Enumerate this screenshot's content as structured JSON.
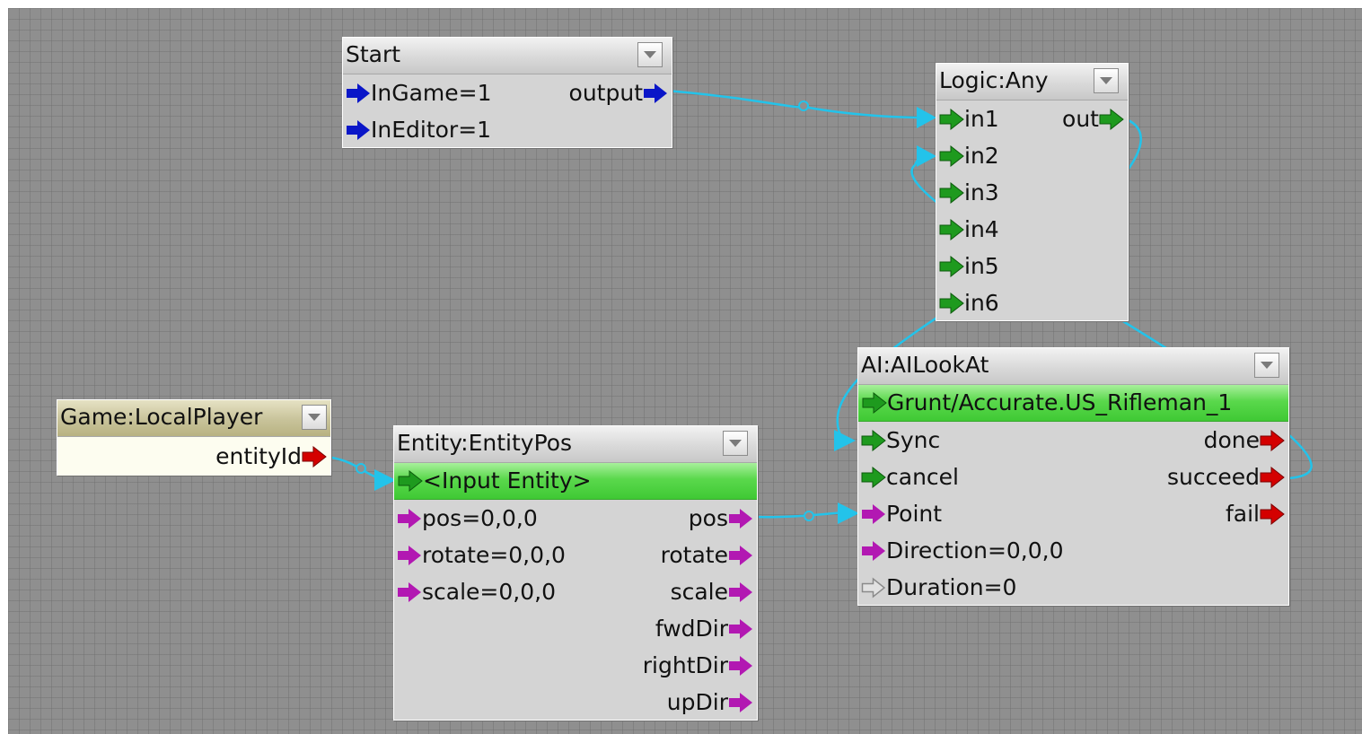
{
  "colors": {
    "canvas": "#8f8f8f",
    "node_body": "#d4d4d4",
    "wire": "#23c3ea",
    "port_blue": "#0a16c8",
    "port_green": "#1e9a1e",
    "port_magenta": "#b218b2",
    "port_red": "#d40000",
    "port_gray": "#9a9a9a",
    "entity_row": "#4fd443"
  },
  "nodes": {
    "start": {
      "title": "Start",
      "inputs": [
        {
          "label": "InGame=1",
          "port_icon": "blue-arrow-icon"
        },
        {
          "label": "InEditor=1",
          "port_icon": "blue-arrow-icon"
        }
      ],
      "outputs": [
        {
          "label": "output",
          "port_icon": "blue-arrow-icon"
        }
      ]
    },
    "logic_any": {
      "title": "Logic:Any",
      "inputs": [
        {
          "label": "in1",
          "port_icon": "green-arrow-icon"
        },
        {
          "label": "in2",
          "port_icon": "green-arrow-icon"
        },
        {
          "label": "in3",
          "port_icon": "green-arrow-icon"
        },
        {
          "label": "in4",
          "port_icon": "green-arrow-icon"
        },
        {
          "label": "in5",
          "port_icon": "green-arrow-icon"
        },
        {
          "label": "in6",
          "port_icon": "green-arrow-icon"
        }
      ],
      "outputs": [
        {
          "label": "out",
          "port_icon": "green-arrow-icon"
        }
      ]
    },
    "local_player": {
      "title": "Game:LocalPlayer",
      "outputs": [
        {
          "label": "entityId",
          "port_icon": "red-arrow-icon"
        }
      ]
    },
    "entity_pos": {
      "title": "Entity:EntityPos",
      "entity": "<Input Entity>",
      "inputs": [
        {
          "label": "pos=0,0,0",
          "port_icon": "magenta-arrow-icon"
        },
        {
          "label": "rotate=0,0,0",
          "port_icon": "magenta-arrow-icon"
        },
        {
          "label": "scale=0,0,0",
          "port_icon": "magenta-arrow-icon"
        }
      ],
      "outputs": [
        {
          "label": "pos",
          "port_icon": "magenta-arrow-icon"
        },
        {
          "label": "rotate",
          "port_icon": "magenta-arrow-icon"
        },
        {
          "label": "scale",
          "port_icon": "magenta-arrow-icon"
        },
        {
          "label": "fwdDir",
          "port_icon": "magenta-arrow-icon"
        },
        {
          "label": "rightDir",
          "port_icon": "magenta-arrow-icon"
        },
        {
          "label": "upDir",
          "port_icon": "magenta-arrow-icon"
        }
      ]
    },
    "ai_lookat": {
      "title": "AI:AILookAt",
      "entity": "Grunt/Accurate.US_Rifleman_1",
      "inputs": [
        {
          "label": "Sync",
          "port_icon": "green-arrow-icon"
        },
        {
          "label": "cancel",
          "port_icon": "green-arrow-icon"
        },
        {
          "label": "Point",
          "port_icon": "magenta-arrow-icon"
        },
        {
          "label": "Direction=0,0,0",
          "port_icon": "magenta-arrow-icon"
        },
        {
          "label": "Duration=0",
          "port_icon": "gray-outline-arrow-icon"
        }
      ],
      "outputs": [
        {
          "label": "done",
          "port_icon": "red-arrow-icon"
        },
        {
          "label": "succeed",
          "port_icon": "red-arrow-icon"
        },
        {
          "label": "fail",
          "port_icon": "red-arrow-icon"
        }
      ]
    }
  },
  "links": [
    {
      "from": "Start.output",
      "to": "Logic:Any.in1"
    },
    {
      "from": "Logic:Any.out",
      "to": "AI:AILookAt.Sync"
    },
    {
      "from": "AI:AILookAt.succeed",
      "to": "Logic:Any.in2"
    },
    {
      "from": "Game:LocalPlayer.entityId",
      "to": "Entity:EntityPos.<Input Entity>"
    },
    {
      "from": "Entity:EntityPos.pos",
      "to": "AI:AILookAt.Point"
    }
  ]
}
